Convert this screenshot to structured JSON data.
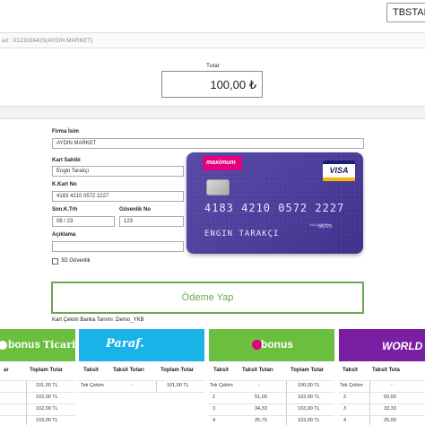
{
  "header": {
    "select_value": "TBSTAHSİLAT"
  },
  "merchant": {
    "line": "ari : 0123024423(AYDIN MARKET)"
  },
  "amount": {
    "label": "Tutar",
    "value": "100,00 ₺"
  },
  "form": {
    "firm_label": "Firma İsim",
    "firm_value": "AYDIN MARKET",
    "holder_label": "Kart Sahibi",
    "holder_value": "Engin Tarakçı",
    "cardno_label": "K.Kart No",
    "cardno_value": "4183 4210 0572 2227",
    "expiry_label": "Son.K.Trh",
    "expiry_value": "08 / 23",
    "cvv_label": "Güvenlik No",
    "cvv_value": "123",
    "desc_label": "Açıklama",
    "desc_value": "",
    "secure_label": "3D Güvenlik"
  },
  "card": {
    "brand": "maximum",
    "network": "VISA",
    "number": "4183 4210 0572 2227",
    "valid_label": "VALID THRU",
    "expiry": "08/23",
    "holder": "ENGIN TARAKÇI"
  },
  "pay_button": "Ödeme Yap",
  "bank_def": "Kart Çekim Banka Tanımı :Demo_YKB",
  "banners": [
    {
      "text_a": "bonus",
      "text_b": "Ticari",
      "bg": "#6bbf3f"
    },
    {
      "text_a": "Paraf.",
      "text_b": "",
      "bg": "#1ab3e8"
    },
    {
      "text_a": "bonus",
      "text_b": "",
      "bg": "#6bbf3f"
    },
    {
      "text_a": "WORLD",
      "text_b": "",
      "bg": "#7b1fa2"
    }
  ],
  "tables": [
    {
      "headers": [
        "ar",
        "Toplam Tutar"
      ],
      "rows": [
        [
          "",
          "101,00 TL"
        ],
        [
          "",
          "102,00 TL"
        ],
        [
          "",
          "102,00 TL"
        ],
        [
          "",
          "103,00 TL"
        ]
      ]
    },
    {
      "headers": [
        "Taksit",
        "Taksit Tutarı",
        "Toplam Tutar"
      ],
      "rows": [
        [
          "Tek Çekim",
          "-",
          "101,00 TL"
        ]
      ]
    },
    {
      "headers": [
        "Taksit",
        "Taksit Tutarı",
        "Toplam Tutar"
      ],
      "rows": [
        [
          "Tek Çekim",
          "-",
          "100,00 TL"
        ],
        [
          "2",
          "51,00",
          "102,00 TL"
        ],
        [
          "3",
          "34,33",
          "103,00 TL"
        ],
        [
          "4",
          "25,75",
          "103,00 TL"
        ]
      ]
    },
    {
      "headers": [
        "Taksit",
        "Taksit Tuta"
      ],
      "rows": [
        [
          "Tek Çekim",
          "-"
        ],
        [
          "2",
          "50,00"
        ],
        [
          "3",
          "33,33"
        ],
        [
          "4",
          "25,00"
        ]
      ]
    }
  ]
}
